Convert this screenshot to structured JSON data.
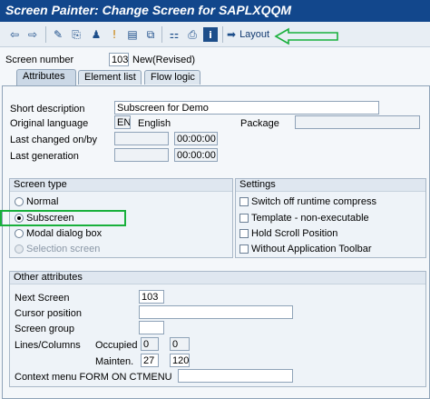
{
  "window": {
    "title": "Screen Painter: Change Screen for SAPLXQQM"
  },
  "toolbar": {
    "icons": [
      "back-arrow-icon",
      "forward-arrow-icon",
      "display-change-icon",
      "other-object-icon",
      "check-icon",
      "activate-icon",
      "where-used-icon",
      "hierarchy-icon",
      "print-icon",
      "info-icon"
    ],
    "layout_label": "Layout"
  },
  "header": {
    "screen_number_label": "Screen number",
    "screen_number": "103",
    "status": "New(Revised)"
  },
  "tabs": [
    {
      "label": "Attributes",
      "active": true
    },
    {
      "label": "Element list",
      "active": false
    },
    {
      "label": "Flow logic",
      "active": false
    }
  ],
  "attributes": {
    "short_description_label": "Short description",
    "short_description": "Subscreen for Demo",
    "original_language_label": "Original language",
    "language_code": "EN",
    "language_name": "English",
    "package_label": "Package",
    "package": "",
    "last_changed_label": "Last changed on/by",
    "last_changed_date": "",
    "last_changed_time": "00:00:00",
    "last_generation_label": "Last generation",
    "last_generation_date": "",
    "last_generation_time": "00:00:00"
  },
  "screen_type": {
    "title": "Screen type",
    "options": [
      {
        "label": "Normal",
        "selected": false,
        "disabled": false
      },
      {
        "label": "Subscreen",
        "selected": true,
        "disabled": false
      },
      {
        "label": "Modal dialog box",
        "selected": false,
        "disabled": false
      },
      {
        "label": "Selection screen",
        "selected": false,
        "disabled": true
      }
    ]
  },
  "settings": {
    "title": "Settings",
    "options": [
      {
        "label": "Switch off runtime compress",
        "checked": false
      },
      {
        "label": "Template - non-executable",
        "checked": false
      },
      {
        "label": "Hold Scroll Position",
        "checked": false
      },
      {
        "label": "Without Application Toolbar",
        "checked": false
      }
    ]
  },
  "other_attributes": {
    "title": "Other attributes",
    "next_screen_label": "Next Screen",
    "next_screen": "103",
    "cursor_position_label": "Cursor position",
    "cursor_position": "",
    "screen_group_label": "Screen group",
    "screen_group": "",
    "lines_columns_label": "Lines/Columns",
    "occupied_label": "Occupied",
    "occupied_lines": "0",
    "occupied_columns": "0",
    "mainten_label": "Mainten.",
    "mainten_lines": "27",
    "mainten_columns": "120",
    "context_menu_label": "Context menu FORM ON CTMENU",
    "context_menu": ""
  },
  "colors": {
    "title_bar": "#12478c",
    "annotation": "#19b03c"
  }
}
